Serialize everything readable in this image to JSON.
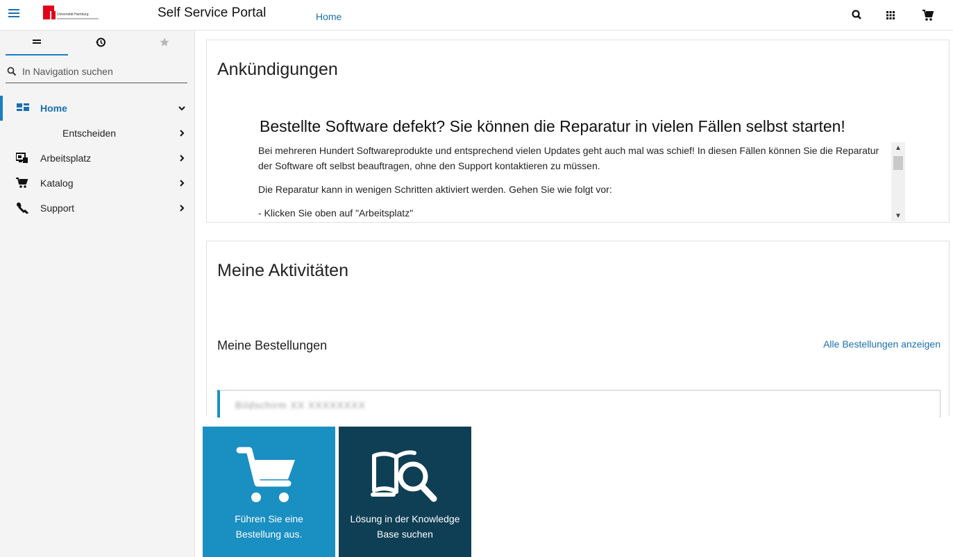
{
  "header": {
    "logo_text": "Universität Hamburg",
    "title": "Self Service Portal",
    "nav_link": "Home"
  },
  "sidebar": {
    "search_placeholder": "In Navigation suchen",
    "items": [
      {
        "label": "Home",
        "icon": "dashboard-icon"
      },
      {
        "label": "Entscheiden",
        "icon": ""
      },
      {
        "label": "Arbeitsplatz",
        "icon": "workstation-icon"
      },
      {
        "label": "Katalog",
        "icon": "cart-icon"
      },
      {
        "label": "Support",
        "icon": "wrench-icon"
      }
    ]
  },
  "announcements": {
    "title": "Ankündigungen",
    "headline": "Bestellte Software defekt? Sie können die Reparatur in vielen Fällen selbst starten!",
    "para1": "Bei mehreren Hundert Softwareprodukte und entsprechend vielen Updates geht auch mal was schief! In diesen Fällen können Sie die Reparatur der Software oft selbst beauftragen, ohne den Support kontaktieren zu müssen.",
    "para2": "Die Reparatur kann in wenigen Schritten aktiviert werden. Gehen Sie wie folgt vor:",
    "para3": "- Klicken Sie oben auf \"Arbeitsplatz\""
  },
  "activities": {
    "title": "Meine Aktivitäten",
    "orders_label": "Meine Bestellungen",
    "orders_link": "Alle Bestellungen anzeigen",
    "order_item": "Bildschirm XX XXXXXXXX"
  },
  "tiles": [
    {
      "label": "Führen Sie eine\nBestellung aus.",
      "icon": "shopping-cart-icon",
      "color": "#1a8fc2"
    },
    {
      "label": "Lösung in der Knowledge\nBase suchen",
      "icon": "book-search-icon",
      "color": "#0f3f55"
    }
  ]
}
